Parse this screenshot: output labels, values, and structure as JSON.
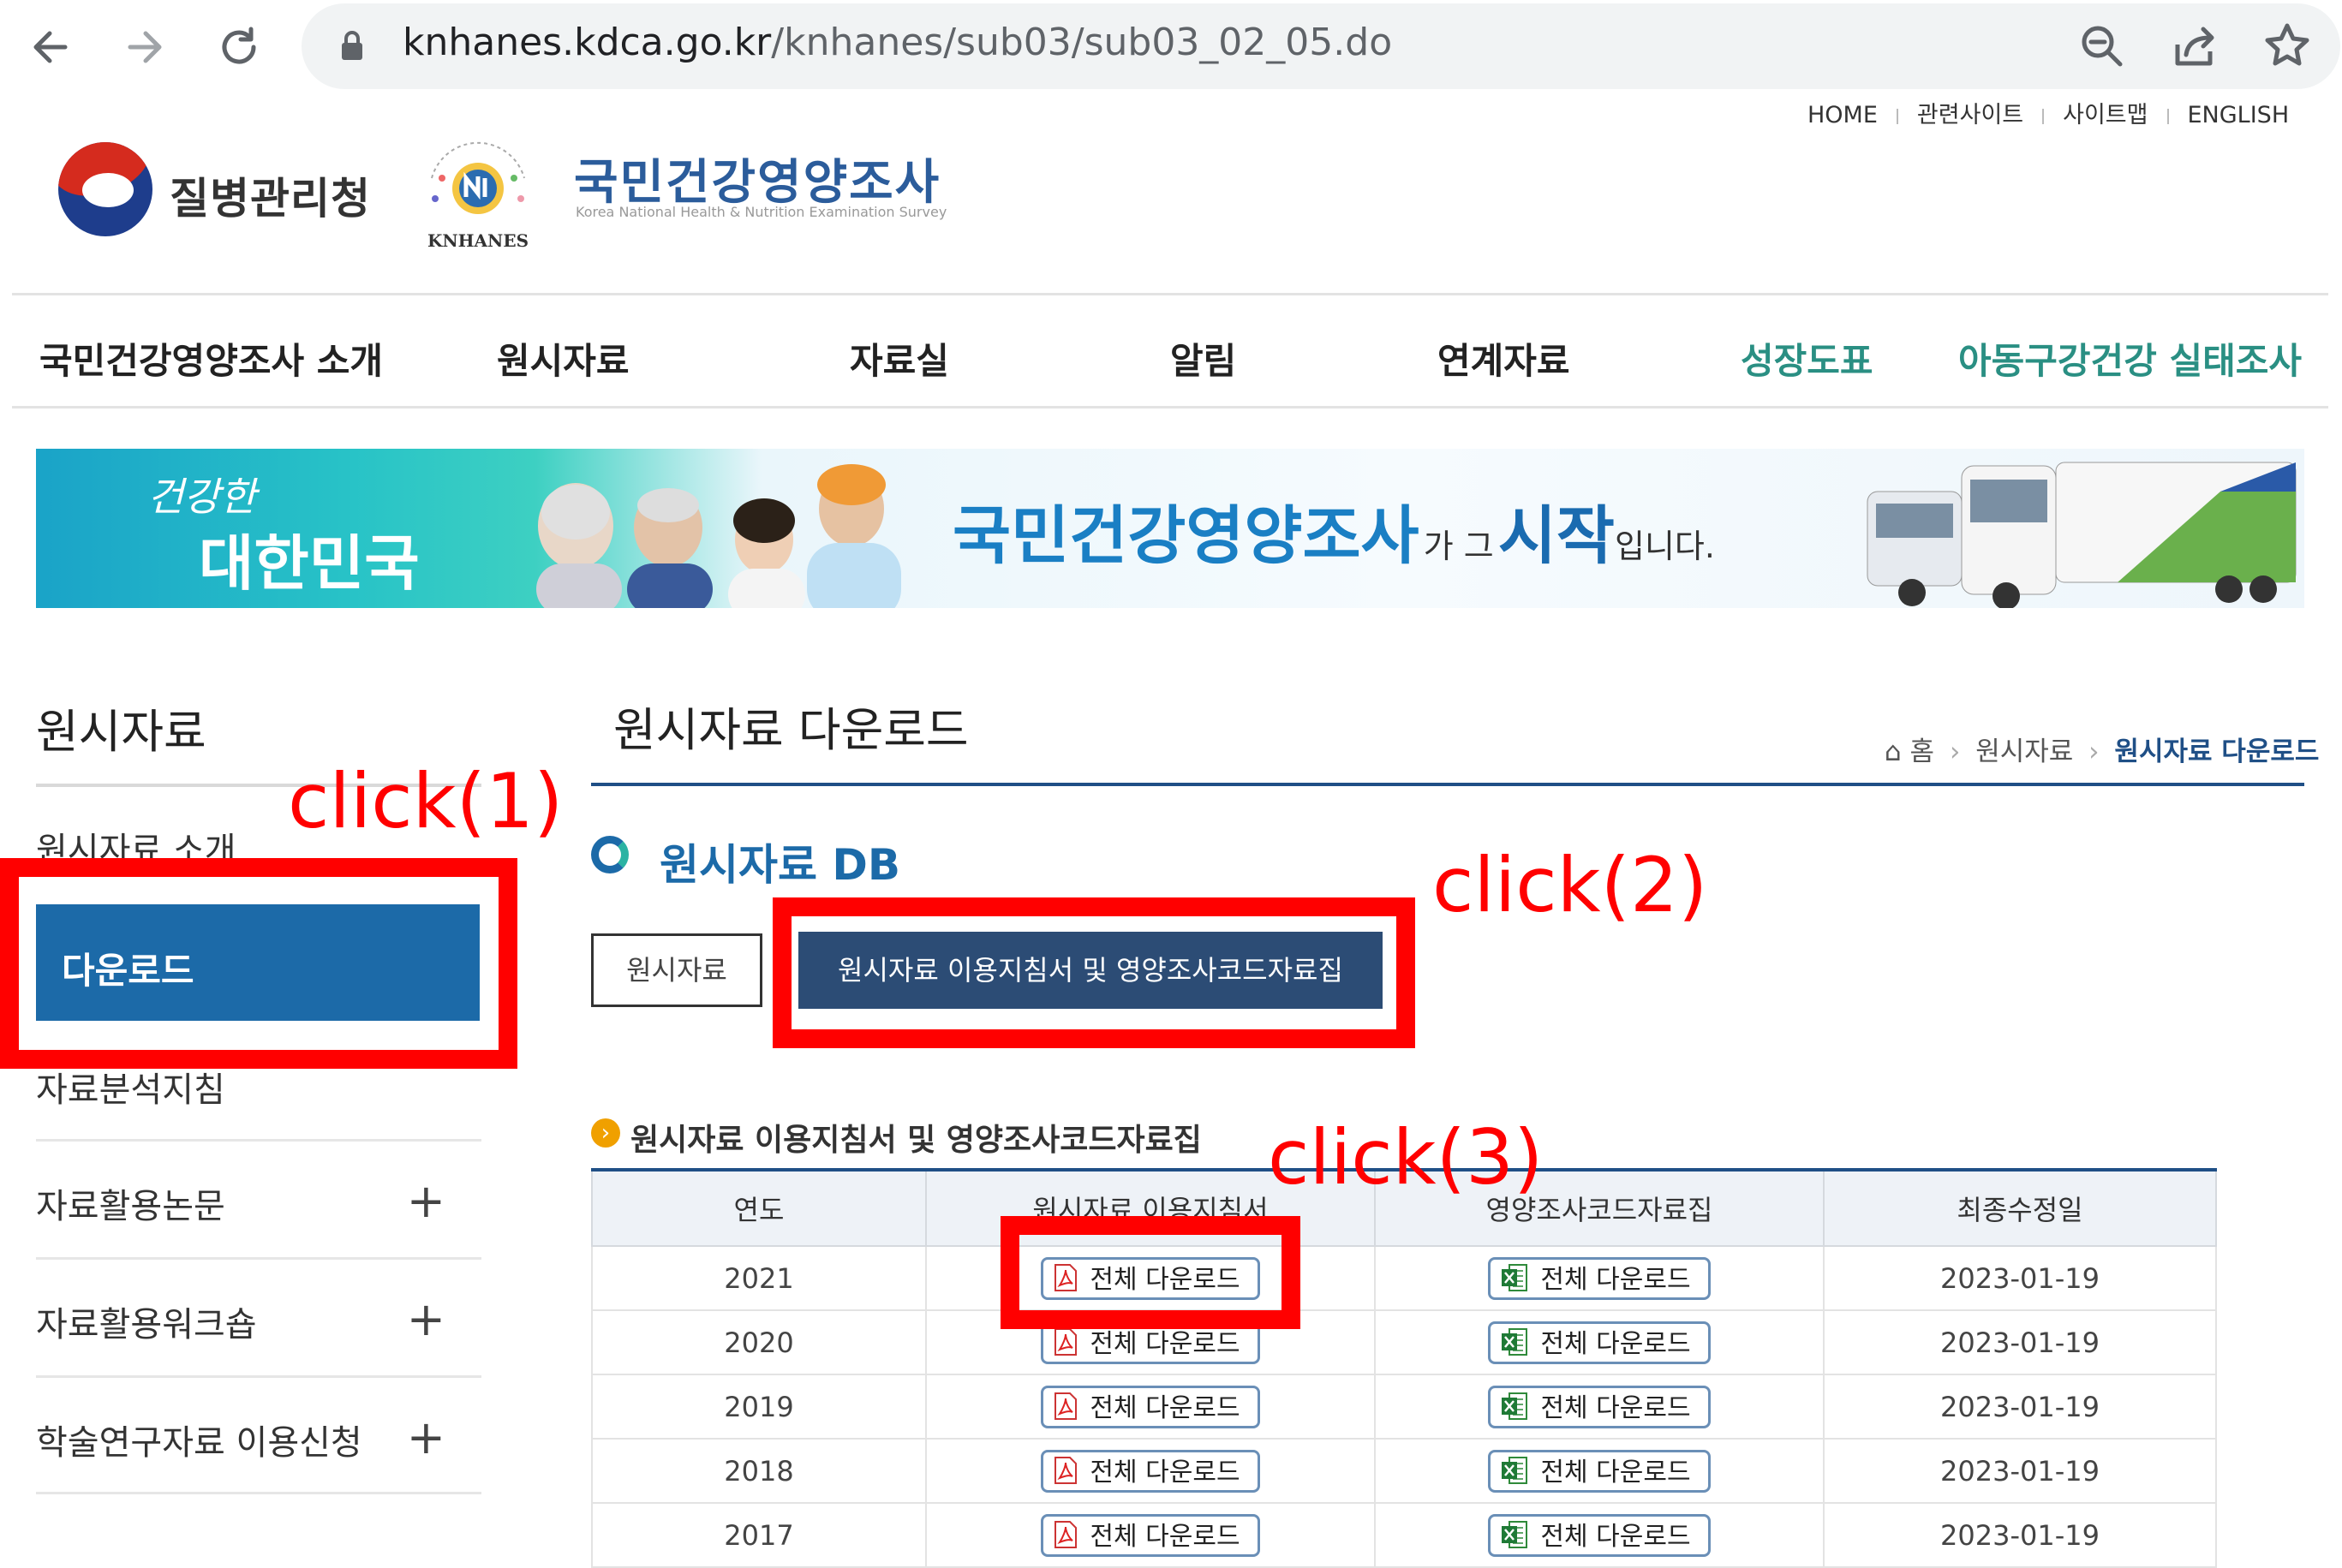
{
  "browser": {
    "url_host": "knhanes.kdca.go.kr",
    "url_path": "/knhanes/sub03/sub03_02_05.do",
    "icons": [
      "back-icon",
      "forward-icon",
      "reload-icon",
      "lock-icon",
      "zoom-icon",
      "share-icon",
      "star-icon"
    ]
  },
  "util_links": [
    "HOME",
    "관련사이트",
    "사이트맵",
    "ENGLISH"
  ],
  "header": {
    "agency_name": "질병관리청",
    "site_title": "국민건강영양조사",
    "site_subtitle": "Korea National Health & Nutrition Examination Survey",
    "emblem_text": "KNHANES"
  },
  "gnb": [
    "국민건강영양조사 소개",
    "원시자료",
    "자료실",
    "알림",
    "연계자료",
    "성장도표",
    "아동구강건강 실태조사"
  ],
  "banner": {
    "slogan_small": "건강한",
    "slogan_large": "대한민국",
    "main_big1": "국민건강영양조사",
    "main_small1": "가 그",
    "main_big2": "시작",
    "main_small2": "입니다."
  },
  "sidebar": {
    "title": "원시자료",
    "items": [
      "원시자료 소개",
      "다운로드",
      "자료분석지침",
      "자료활용논문",
      "자료활용워크숍",
      "학술연구자료 이용신청"
    ],
    "plus": "+"
  },
  "content": {
    "page_title": "원시자료 다운로드",
    "breadcrumb": [
      "홈",
      "원시자료",
      "원시자료 다운로드"
    ],
    "section_title": "원시자료 DB",
    "tabs": [
      "원시자료",
      "원시자료 이용지침서 및 영양조사코드자료집"
    ],
    "subsection_title": "원시자료 이용지침서 및 영양조사코드자료집",
    "table": {
      "headers": [
        "연도",
        "원시자료 이용지침서",
        "영양조사코드자료집",
        "최종수정일"
      ],
      "download_label": "전체 다운로드",
      "rows": [
        {
          "year": "2021",
          "date": "2023-01-19"
        },
        {
          "year": "2020",
          "date": "2023-01-19"
        },
        {
          "year": "2019",
          "date": "2023-01-19"
        },
        {
          "year": "2018",
          "date": "2023-01-19"
        },
        {
          "year": "2017",
          "date": "2023-01-19"
        }
      ]
    }
  },
  "annotations": {
    "click1": "click(1)",
    "click2": "click(2)",
    "click3": "click(3)",
    "color": "#ff0000"
  }
}
